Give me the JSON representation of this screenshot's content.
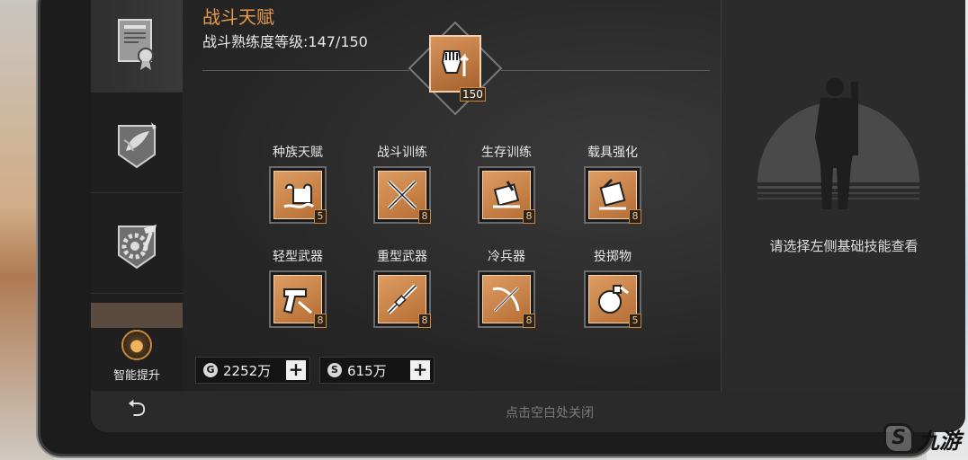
{
  "header": {
    "title": "战斗天赋",
    "level_text": "战斗熟练度等级:147/150"
  },
  "main_skill": {
    "icon": "fist-up-arrow-icon",
    "level": "150"
  },
  "skills": [
    {
      "label": "种族天赋",
      "level": "5",
      "icon": "scroll-icon"
    },
    {
      "label": "战斗训练",
      "level": "8",
      "icon": "crossed-swords-icon"
    },
    {
      "label": "生存训练",
      "level": "8",
      "icon": "survival-kit-icon"
    },
    {
      "label": "载具强化",
      "level": "8",
      "icon": "vehicle-tools-icon"
    },
    {
      "label": "轻型武器",
      "level": "8",
      "icon": "pistol-icon"
    },
    {
      "label": "重型武器",
      "level": "8",
      "icon": "heavy-gun-icon"
    },
    {
      "label": "冷兵器",
      "level": "8",
      "icon": "crossbow-icon"
    },
    {
      "label": "投掷物",
      "level": "5",
      "icon": "grenade-icon"
    }
  ],
  "sidebar": {
    "tabs": [
      {
        "icon": "certificate-icon",
        "active": true
      },
      {
        "icon": "leaf-emblem-icon",
        "active": false
      },
      {
        "icon": "gear-hammer-icon",
        "active": false
      }
    ],
    "smart_upgrade_label": "智能提升"
  },
  "currency": [
    {
      "icon_glyph": "G",
      "value": "2252万",
      "icon": "gold-coin-icon"
    },
    {
      "icon_glyph": "S",
      "value": "615万",
      "icon": "silver-coin-icon"
    }
  ],
  "right_panel": {
    "hint": "请选择左侧基础技能查看"
  },
  "footer": {
    "close_hint": "点击空白处关闭",
    "back_glyph": "⮌"
  },
  "watermark": {
    "logo_glyph": "S",
    "text": "九游"
  },
  "colors": {
    "accent_orange": "#e79a4d",
    "skill_fill": "#d08a4c"
  }
}
